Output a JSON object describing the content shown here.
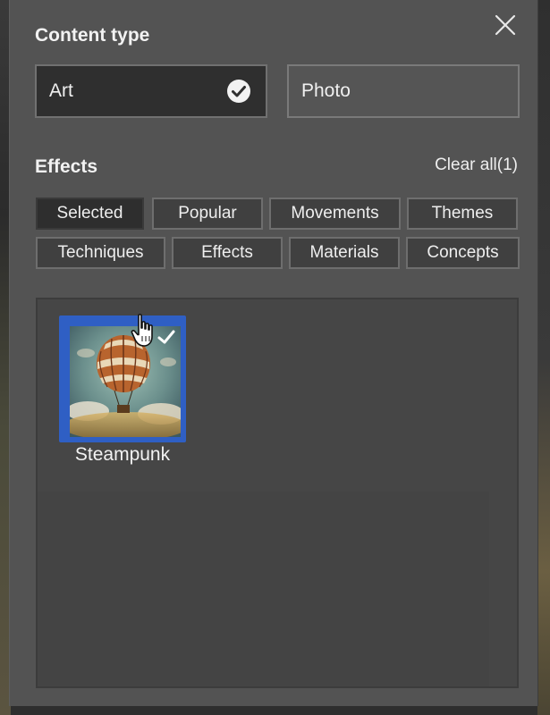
{
  "content_type": {
    "title": "Content type",
    "options": [
      {
        "label": "Art",
        "selected": true
      },
      {
        "label": "Photo",
        "selected": false
      }
    ]
  },
  "effects": {
    "title": "Effects",
    "clear_all_label": "Clear all(1)",
    "filters": [
      {
        "label": "Selected",
        "active": true
      },
      {
        "label": "Popular",
        "active": false
      },
      {
        "label": "Movements",
        "active": false
      },
      {
        "label": "Themes",
        "active": false
      },
      {
        "label": "Techniques",
        "active": false
      },
      {
        "label": "Effects",
        "active": false
      },
      {
        "label": "Materials",
        "active": false
      },
      {
        "label": "Concepts",
        "active": false
      }
    ],
    "items": [
      {
        "label": "Steampunk",
        "selected": true,
        "thumbnail": "hot-air-balloon-image"
      }
    ]
  },
  "icons": {
    "close": "close-icon",
    "check": "checkmark-circle-icon",
    "cursor": "hand-pointer-icon"
  },
  "colors": {
    "panel_bg": "#535353",
    "selected_bg": "#2e2e2e",
    "accent_blue": "#2f5fc4",
    "text": "#f0f0f0"
  }
}
